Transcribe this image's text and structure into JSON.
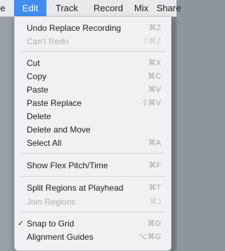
{
  "menubar": {
    "items": [
      {
        "label": "e"
      },
      {
        "label": "Edit"
      },
      {
        "label": "Track"
      },
      {
        "label": "Record"
      },
      {
        "label": "Mix"
      },
      {
        "label": "Share"
      }
    ]
  },
  "menu": {
    "items": [
      {
        "label": "Undo Replace Recording",
        "shortcut": "⌘Z"
      },
      {
        "label": "Can't Redo",
        "shortcut": "⇧⌘Z"
      },
      {
        "label": "Cut",
        "shortcut": "⌘X"
      },
      {
        "label": "Copy",
        "shortcut": "⌘C"
      },
      {
        "label": "Paste",
        "shortcut": "⌘V"
      },
      {
        "label": "Paste Replace",
        "shortcut": "⇧⌘V"
      },
      {
        "label": "Delete",
        "shortcut": ""
      },
      {
        "label": "Delete and Move",
        "shortcut": ""
      },
      {
        "label": "Select All",
        "shortcut": "⌘A"
      },
      {
        "label": "Show Flex Pitch/Time",
        "shortcut": "⌘F"
      },
      {
        "label": "Split Regions at Playhead",
        "shortcut": "⌘T"
      },
      {
        "label": "Join Regions",
        "shortcut": "⌘J"
      },
      {
        "label": "Snap to Grid",
        "shortcut": "⌘G",
        "check": "✓"
      },
      {
        "label": "Alignment Guides",
        "shortcut": "⌥⌘G"
      }
    ]
  }
}
